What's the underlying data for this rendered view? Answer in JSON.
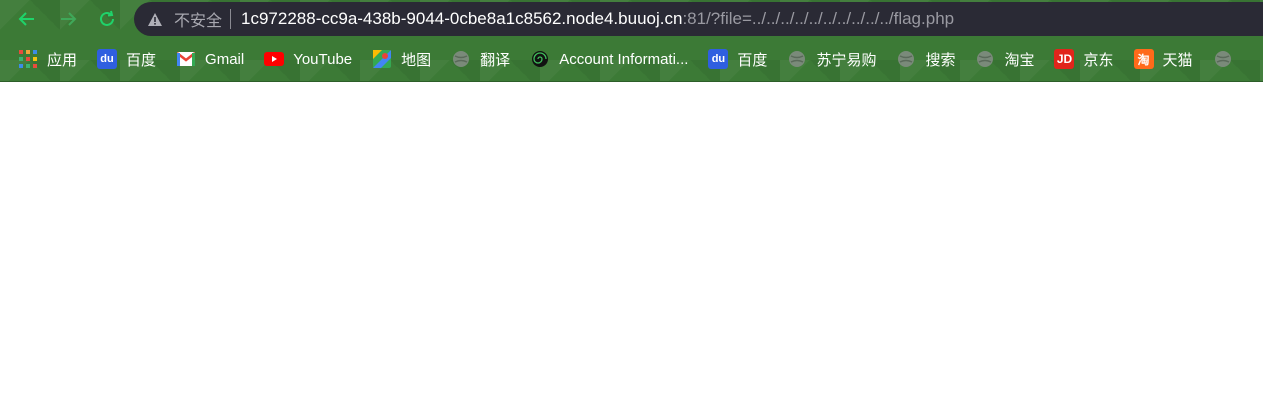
{
  "toolbar": {
    "back_icon": "arrow-left-icon",
    "forward_icon": "arrow-right-icon",
    "reload_icon": "reload-icon"
  },
  "address_bar": {
    "security_label": "不安全",
    "host": "1c972288-cc9a-438b-9044-0cbe8a1c8562.node4.buuoj.cn",
    "path": ":81/?file=../../../../../../../../../../flag.php"
  },
  "bookmarks": [
    {
      "label": "应用",
      "icon": "apps-grid-icon"
    },
    {
      "label": "百度",
      "icon": "baidu-icon"
    },
    {
      "label": "Gmail",
      "icon": "gmail-icon"
    },
    {
      "label": "YouTube",
      "icon": "youtube-icon"
    },
    {
      "label": "地图",
      "icon": "maps-icon"
    },
    {
      "label": "翻译",
      "icon": "globe-icon"
    },
    {
      "label": "Account Informati...",
      "icon": "spiral-icon"
    },
    {
      "label": "百度",
      "icon": "baidu-icon"
    },
    {
      "label": "苏宁易购",
      "icon": "globe-icon"
    },
    {
      "label": "搜索",
      "icon": "globe-icon"
    },
    {
      "label": "淘宝",
      "icon": "globe-icon"
    },
    {
      "label": "京东",
      "icon": "jd-icon"
    },
    {
      "label": "天猫",
      "icon": "tmall-icon"
    },
    {
      "label": "",
      "icon": "globe-icon"
    }
  ],
  "colors": {
    "frame": "#3c7a36",
    "omnibox": "#2a2a35",
    "accent": "#1fd36a"
  }
}
